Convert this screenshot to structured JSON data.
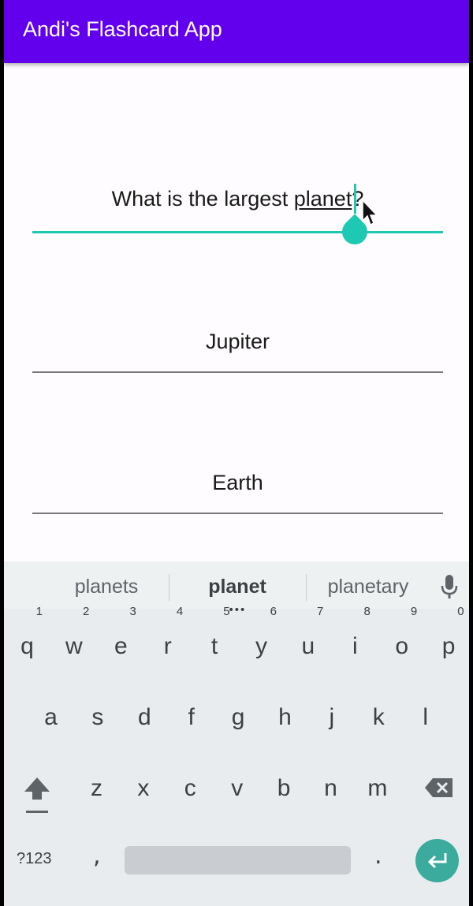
{
  "app": {
    "title": "Andi's Flashcard App",
    "accent": "#6200ee",
    "field_accent": "#1ec9b3"
  },
  "question": {
    "prefix": "What is the largest ",
    "underlined": "planet",
    "suffix": "?"
  },
  "answers": [
    {
      "value": "Jupiter"
    },
    {
      "value": "Earth"
    }
  ],
  "keyboard": {
    "suggestions": [
      "planets",
      "planet",
      "planetary"
    ],
    "rows": [
      [
        "q",
        "w",
        "e",
        "r",
        "t",
        "y",
        "u",
        "i",
        "o",
        "p"
      ],
      [
        "a",
        "s",
        "d",
        "f",
        "g",
        "h",
        "j",
        "k",
        "l"
      ],
      [
        "z",
        "x",
        "c",
        "v",
        "b",
        "n",
        "m"
      ]
    ],
    "number_hints": [
      "1",
      "2",
      "3",
      "4",
      "5",
      "6",
      "7",
      "8",
      "9",
      "0"
    ],
    "symbols_label": "?123",
    "comma": ",",
    "period": ".",
    "icons": [
      "shift-icon",
      "backspace-icon",
      "enter-icon",
      "mic-icon"
    ]
  }
}
